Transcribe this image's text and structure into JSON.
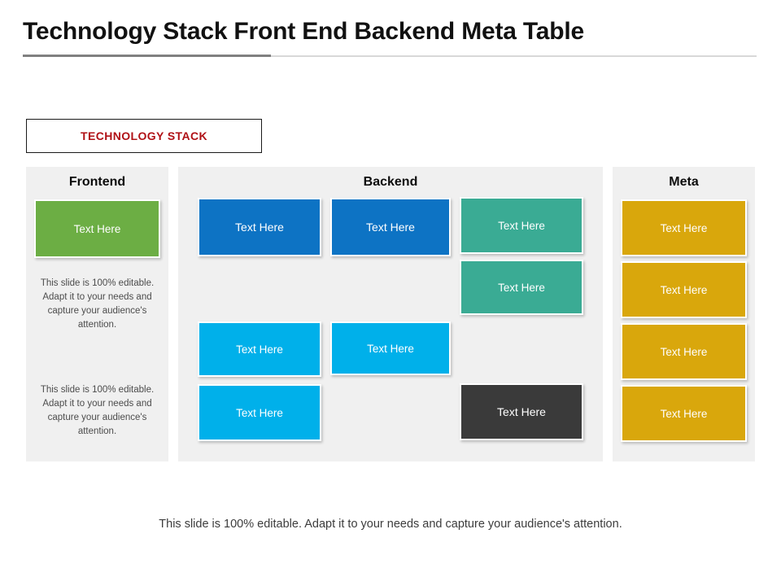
{
  "slide": {
    "title": "Technology Stack Front End Backend Meta Table",
    "badge_label": "TECHNOLOGY STACK",
    "footer_note": "This slide is 100% editable. Adapt it to your needs and capture your audience's attention."
  },
  "colors": {
    "accent_red": "#b01116",
    "panel_bg": "#f0f0f0",
    "green": "#6cae44",
    "dark_blue": "#0d73c4",
    "light_blue": "#00b0ea",
    "teal": "#3aab94",
    "gold": "#d9a70c",
    "dark_gray": "#3a3a3a",
    "rule_dark": "#808080",
    "rule_light": "#d8d8d8"
  },
  "columns": {
    "frontend": {
      "header": "Frontend",
      "box_label": "Text Here",
      "paragraphs": [
        "This slide is 100% editable. Adapt  it to your needs and capture your audience's attention.",
        "This slide is 100% editable. Adapt  it to your needs and capture your audience's attention."
      ]
    },
    "backend": {
      "header": "Backend",
      "boxes": [
        {
          "label": "Text Here",
          "color": "dark_blue"
        },
        {
          "label": "Text Here",
          "color": "dark_blue"
        },
        {
          "label": "Text Here",
          "color": "teal"
        },
        {
          "label": "Text Here",
          "color": "teal"
        },
        {
          "label": "Text Here",
          "color": "light_blue"
        },
        {
          "label": "Text Here",
          "color": "light_blue"
        },
        {
          "label": "Text Here",
          "color": "light_blue"
        },
        {
          "label": "Text Here",
          "color": "dark_gray"
        }
      ]
    },
    "meta": {
      "header": "Meta",
      "boxes": [
        {
          "label": "Text Here"
        },
        {
          "label": "Text Here"
        },
        {
          "label": "Text Here"
        },
        {
          "label": "Text Here"
        }
      ]
    }
  }
}
